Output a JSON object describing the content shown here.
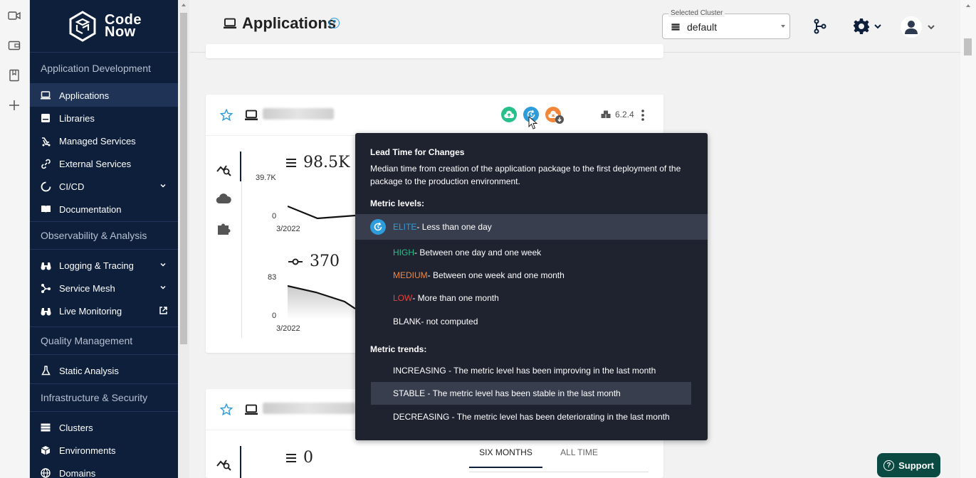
{
  "logo": {
    "line1": "Code",
    "line2": "Now"
  },
  "sidebar": {
    "sections": [
      {
        "title": "Application Development",
        "items": [
          {
            "label": "Applications",
            "icon": "laptop-icon",
            "active": true
          },
          {
            "label": "Libraries",
            "icon": "library-icon"
          },
          {
            "label": "Managed Services",
            "icon": "plug-icon"
          },
          {
            "label": "External Services",
            "icon": "link-icon"
          },
          {
            "label": "CI/CD",
            "icon": "cicd-icon",
            "expand": true
          },
          {
            "label": "Documentation",
            "icon": "book-icon"
          }
        ]
      },
      {
        "title": "Observability & Analysis",
        "items": [
          {
            "label": "Logging & Tracing",
            "icon": "binoculars-icon",
            "expand": true
          },
          {
            "label": "Service Mesh",
            "icon": "mesh-icon",
            "expand": true
          },
          {
            "label": "Live Monitoring",
            "icon": "binoculars-icon",
            "external": true
          }
        ]
      },
      {
        "title": "Quality Management",
        "items": [
          {
            "label": "Static Analysis",
            "icon": "flask-icon"
          }
        ]
      },
      {
        "title": "Infrastructure & Security",
        "items": [
          {
            "label": "Clusters",
            "icon": "server-icon"
          },
          {
            "label": "Environments",
            "icon": "cube-icon"
          },
          {
            "label": "Domains",
            "icon": "globe-icon"
          }
        ]
      }
    ]
  },
  "header": {
    "title": "Applications",
    "help": "?",
    "cluster_label": "Selected Cluster",
    "cluster_value": "default"
  },
  "card1": {
    "version": "6.2.4",
    "metric1": {
      "value": "98.5K",
      "ymax": "39.7K",
      "ymin": "0",
      "xlabel": "3/2022"
    },
    "metric2": {
      "value": "370",
      "ymax": "83",
      "ymin": "0",
      "xlabel": "3/2022"
    }
  },
  "card2": {
    "metric1": {
      "value": "0"
    },
    "tabs": [
      "SIX MONTHS",
      "ALL TIME"
    ]
  },
  "tooltip": {
    "title": "Lead Time for Changes",
    "description": "Median time from creation of the application package to the first deployment of the package to the production environment.",
    "levels_heading": "Metric levels:",
    "levels": [
      {
        "name": "ELITE",
        "text": " - Less than one day",
        "color": "#2d9cdb"
      },
      {
        "name": "HIGH",
        "text": " - Between one day and one week",
        "color": "#27c08a"
      },
      {
        "name": "MEDIUM",
        "text": " - Between one week and one month",
        "color": "#f2873a"
      },
      {
        "name": "LOW",
        "text": " - More than one month",
        "color": "#e8413a"
      },
      {
        "name": "BLANK",
        "text": " - not computed",
        "color": "#ffffff"
      }
    ],
    "trends_heading": "Metric trends:",
    "trends": [
      "INCREASING - The metric level has been improving in the last month",
      "STABLE - The metric level has been stable in the last month",
      "DECREASING - The metric level has been deteriorating in the last month"
    ]
  },
  "support": {
    "label": "Support",
    "icon": "?"
  },
  "colors": {
    "sidebar": "#0e1f3b",
    "accent": "#2d9cdb",
    "support": "#0a4a42"
  }
}
